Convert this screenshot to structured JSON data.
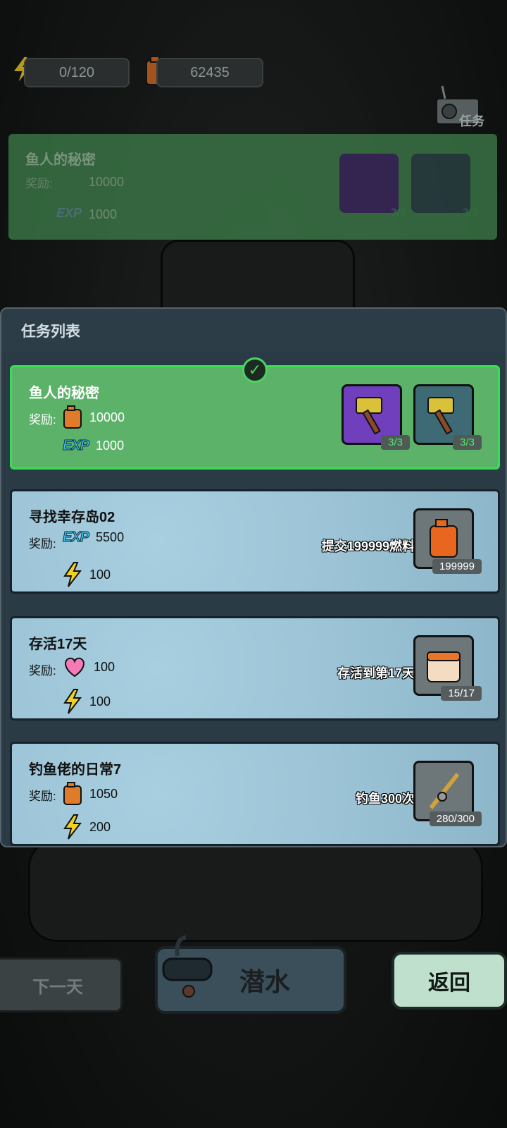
{
  "top_bar": {
    "energy": "0/120",
    "fuel": "62435"
  },
  "radio_label": "任务",
  "ghost_quest": {
    "title": "鱼人的秘密",
    "reward_label": "奖励:",
    "fuel": "10000",
    "exp_label": "EXP",
    "exp": "1000",
    "items": [
      {
        "count": "3/3"
      },
      {
        "count": "3/3"
      }
    ]
  },
  "panel": {
    "title": "任务列表"
  },
  "quests": [
    {
      "title": "鱼人的秘密",
      "reward_label": "奖励:",
      "reward1_value": "10000",
      "exp_label": "EXP",
      "reward2_value": "1000",
      "slot_count_1": "3/3",
      "slot_count_2": "3/3"
    },
    {
      "title": "寻找幸存岛02",
      "reward_label": "奖励:",
      "exp_label": "EXP",
      "reward1_value": "5500",
      "reward2_value": "100",
      "task": "提交199999燃料",
      "slot_count": "199999"
    },
    {
      "title": "存活17天",
      "reward_label": "奖励:",
      "reward1_value": "100",
      "reward2_value": "100",
      "task": "存活到第17天",
      "slot_count": "15/17"
    },
    {
      "title": "钓鱼佬的日常7",
      "reward_label": "奖励:",
      "reward1_value": "1050",
      "reward2_value": "200",
      "task": "钓鱼300次",
      "slot_count": "280/300"
    }
  ],
  "buttons": {
    "next_day": "下一天",
    "dive": "潜水",
    "back": "返回"
  }
}
